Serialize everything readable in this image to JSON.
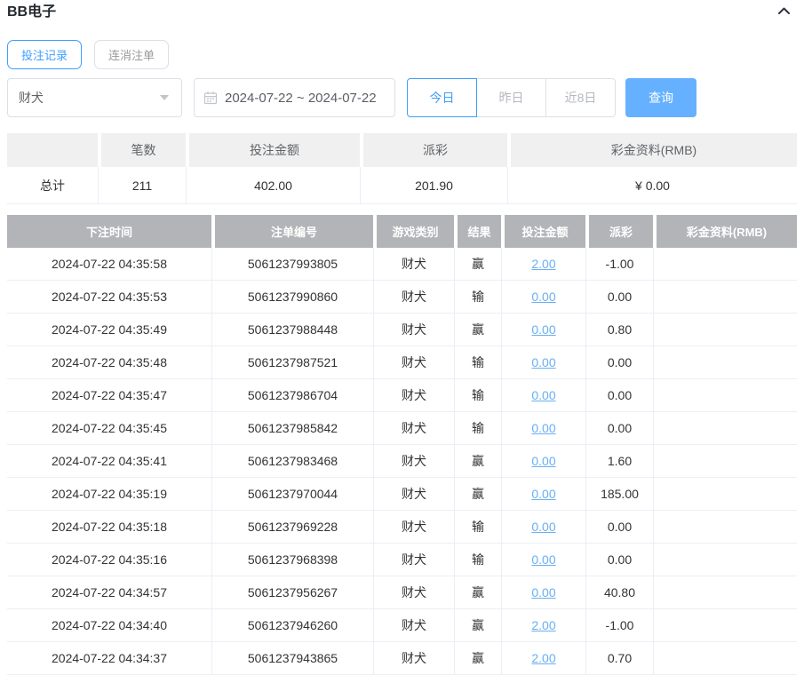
{
  "header": {
    "title": "BB电子"
  },
  "tabs": [
    {
      "label": "投注记录",
      "active": true
    },
    {
      "label": "连消注单",
      "active": false
    }
  ],
  "filters": {
    "game_select": {
      "value": "财犬"
    },
    "date_range": {
      "value": "2024-07-22 ~ 2024-07-22"
    },
    "quick_buttons": [
      {
        "label": "今日",
        "active": true
      },
      {
        "label": "昨日",
        "active": false
      },
      {
        "label": "近8日",
        "active": false
      }
    ],
    "search_button": "查询"
  },
  "summary_table": {
    "headers": [
      "",
      "笔数",
      "投注金额",
      "派彩",
      "彩金资料(RMB)"
    ],
    "row": {
      "label": "总计",
      "count": "211",
      "bet_amount": "402.00",
      "payout": "201.90",
      "bonus": "¥ 0.00"
    }
  },
  "records_table": {
    "headers": [
      "下注时间",
      "注单编号",
      "游戏类别",
      "结果",
      "投注金额",
      "派彩",
      "彩金资料(RMB)"
    ],
    "rows": [
      {
        "time": "2024-07-22 04:35:58",
        "id": "5061237993805",
        "game": "财犬",
        "result": "赢",
        "bet": "2.00",
        "payout": "-1.00",
        "bonus": ""
      },
      {
        "time": "2024-07-22 04:35:53",
        "id": "5061237990860",
        "game": "财犬",
        "result": "输",
        "bet": "0.00",
        "payout": "0.00",
        "bonus": ""
      },
      {
        "time": "2024-07-22 04:35:49",
        "id": "5061237988448",
        "game": "财犬",
        "result": "赢",
        "bet": "0.00",
        "payout": "0.80",
        "bonus": ""
      },
      {
        "time": "2024-07-22 04:35:48",
        "id": "5061237987521",
        "game": "财犬",
        "result": "输",
        "bet": "0.00",
        "payout": "0.00",
        "bonus": ""
      },
      {
        "time": "2024-07-22 04:35:47",
        "id": "5061237986704",
        "game": "财犬",
        "result": "输",
        "bet": "0.00",
        "payout": "0.00",
        "bonus": ""
      },
      {
        "time": "2024-07-22 04:35:45",
        "id": "5061237985842",
        "game": "财犬",
        "result": "输",
        "bet": "0.00",
        "payout": "0.00",
        "bonus": ""
      },
      {
        "time": "2024-07-22 04:35:41",
        "id": "5061237983468",
        "game": "财犬",
        "result": "赢",
        "bet": "0.00",
        "payout": "1.60",
        "bonus": ""
      },
      {
        "time": "2024-07-22 04:35:19",
        "id": "5061237970044",
        "game": "财犬",
        "result": "赢",
        "bet": "0.00",
        "payout": "185.00",
        "bonus": ""
      },
      {
        "time": "2024-07-22 04:35:18",
        "id": "5061237969228",
        "game": "财犬",
        "result": "输",
        "bet": "0.00",
        "payout": "0.00",
        "bonus": ""
      },
      {
        "time": "2024-07-22 04:35:16",
        "id": "5061237968398",
        "game": "财犬",
        "result": "输",
        "bet": "0.00",
        "payout": "0.00",
        "bonus": ""
      },
      {
        "time": "2024-07-22 04:34:57",
        "id": "5061237956267",
        "game": "财犬",
        "result": "赢",
        "bet": "0.00",
        "payout": "40.80",
        "bonus": ""
      },
      {
        "time": "2024-07-22 04:34:40",
        "id": "5061237946260",
        "game": "财犬",
        "result": "赢",
        "bet": "2.00",
        "payout": "-1.00",
        "bonus": ""
      },
      {
        "time": "2024-07-22 04:34:37",
        "id": "5061237943865",
        "game": "财犬",
        "result": "赢",
        "bet": "2.00",
        "payout": "0.70",
        "bonus": ""
      }
    ]
  },
  "icons": {
    "collapse": "chevron-up-icon",
    "calendar": "calendar-icon",
    "select_caret": "caret-down-icon"
  },
  "colors": {
    "accent": "#409eff",
    "button_fill": "#66b1ff",
    "link": "#68aff5",
    "negative": "#f56c6c",
    "table_header_bg": "#b2b4b7",
    "summary_header_bg": "#f0f0f0"
  }
}
